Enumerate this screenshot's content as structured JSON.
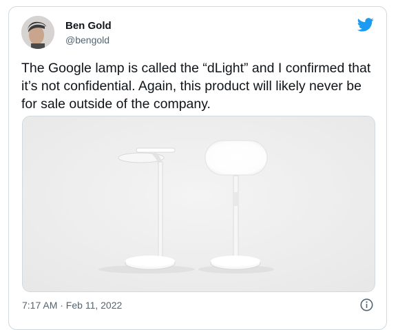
{
  "author": {
    "name": "Ben Gold",
    "handle": "@bengold"
  },
  "tweet": {
    "text": "The Google lamp is called the “dLight” and I confirmed that it’s not confidential. Again, this product will likely never be for sale outside of the company.",
    "timestamp": "7:17 AM · Feb 11, 2022"
  },
  "icons": {
    "brand": "twitter-bird-icon",
    "info": "info-icon"
  },
  "colors": {
    "twitter_blue": "#1d9bf0",
    "text": "#0f1419",
    "secondary_text": "#536471",
    "border": "#cfd9de"
  }
}
